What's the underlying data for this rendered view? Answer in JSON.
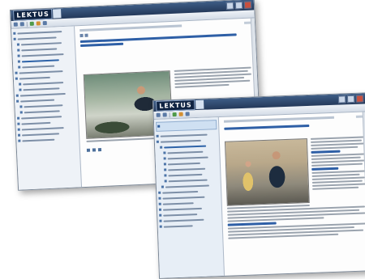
{
  "app": {
    "logo_text": "LEKTUS",
    "brand_color": "#24395a",
    "accent_color": "#2e5fa6"
  },
  "windows": [
    {
      "id": "back",
      "window_buttons": [
        "minimize",
        "maximize",
        "close"
      ],
      "icons": [
        "back-icon",
        "forward-icon",
        "home-icon",
        "print-icon"
      ]
    },
    {
      "id": "front",
      "window_buttons": [
        "minimize",
        "maximize",
        "close"
      ],
      "icons": [
        "back-icon",
        "forward-icon",
        "home-icon",
        "print-icon"
      ]
    }
  ]
}
